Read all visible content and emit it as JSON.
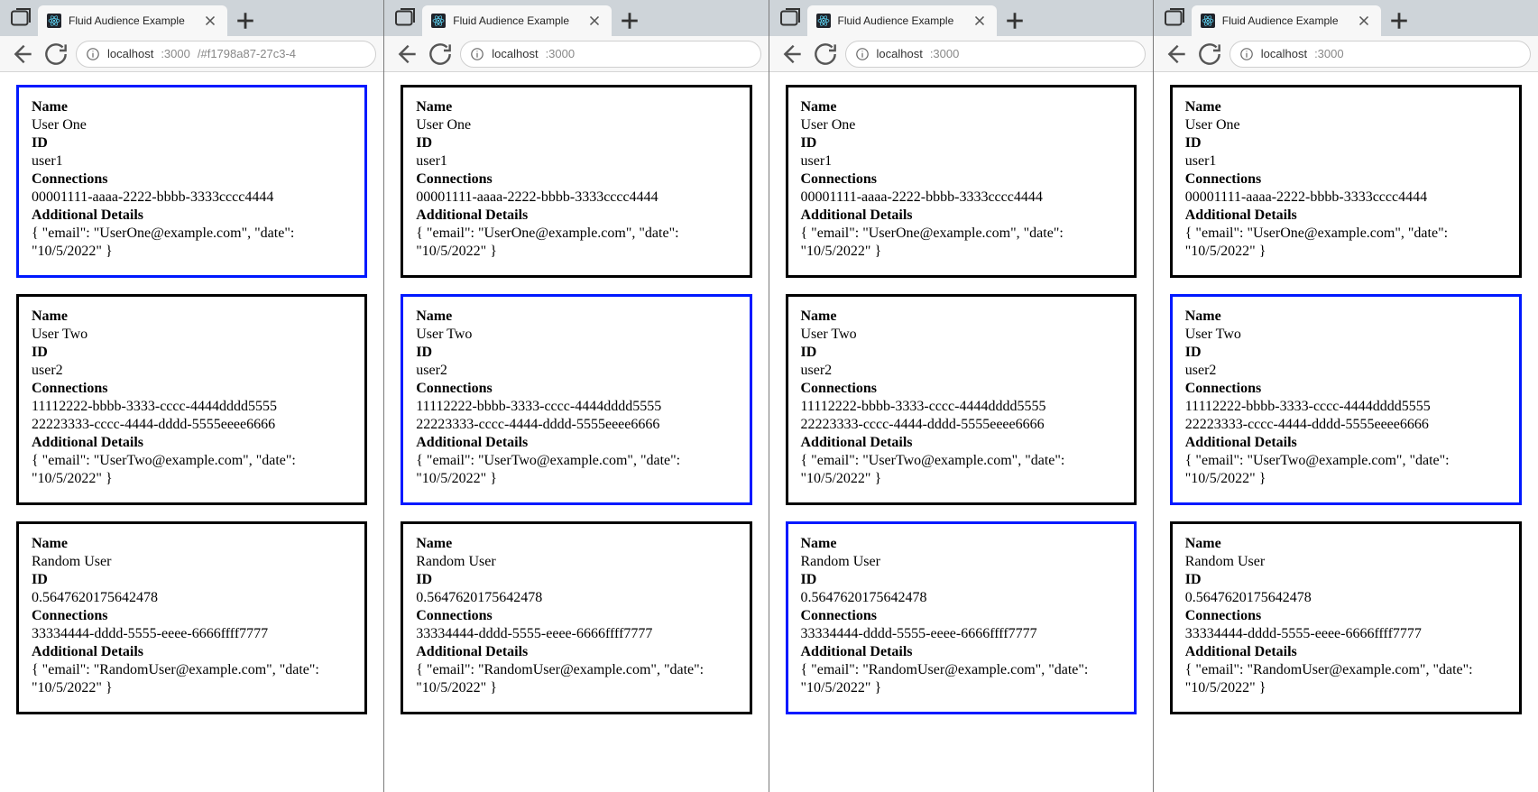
{
  "windows": [
    {
      "tab_title": "Fluid Audience Example",
      "address_host": "localhost",
      "address_port": ":3000",
      "address_path": "/#f1798a87-27c3-4",
      "selected_index": 0
    },
    {
      "tab_title": "Fluid Audience Example",
      "address_host": "localhost",
      "address_port": ":3000",
      "address_path": "",
      "selected_index": 1
    },
    {
      "tab_title": "Fluid Audience Example",
      "address_host": "localhost",
      "address_port": ":3000",
      "address_path": "",
      "selected_index": 2
    },
    {
      "tab_title": "Fluid Audience Example",
      "address_host": "localhost",
      "address_port": ":3000",
      "address_path": "",
      "selected_index": 1
    }
  ],
  "labels": {
    "name": "Name",
    "id": "ID",
    "connections": "Connections",
    "additional_details": "Additional Details"
  },
  "users": [
    {
      "name": "User One",
      "id": "user1",
      "connections": [
        "00001111-aaaa-2222-bbbb-3333cccc4444"
      ],
      "details": "{ \"email\": \"UserOne@example.com\", \"date\": \"10/5/2022\" }"
    },
    {
      "name": "User Two",
      "id": "user2",
      "connections": [
        "11112222-bbbb-3333-cccc-4444dddd5555",
        "22223333-cccc-4444-dddd-5555eeee6666"
      ],
      "details": "{ \"email\": \"UserTwo@example.com\", \"date\": \"10/5/2022\" }"
    },
    {
      "name": "Random User",
      "id": "0.5647620175642478",
      "connections": [
        "33334444-dddd-5555-eeee-6666ffff7777"
      ],
      "details": "{ \"email\": \"RandomUser@example.com\", \"date\": \"10/5/2022\" }"
    }
  ]
}
